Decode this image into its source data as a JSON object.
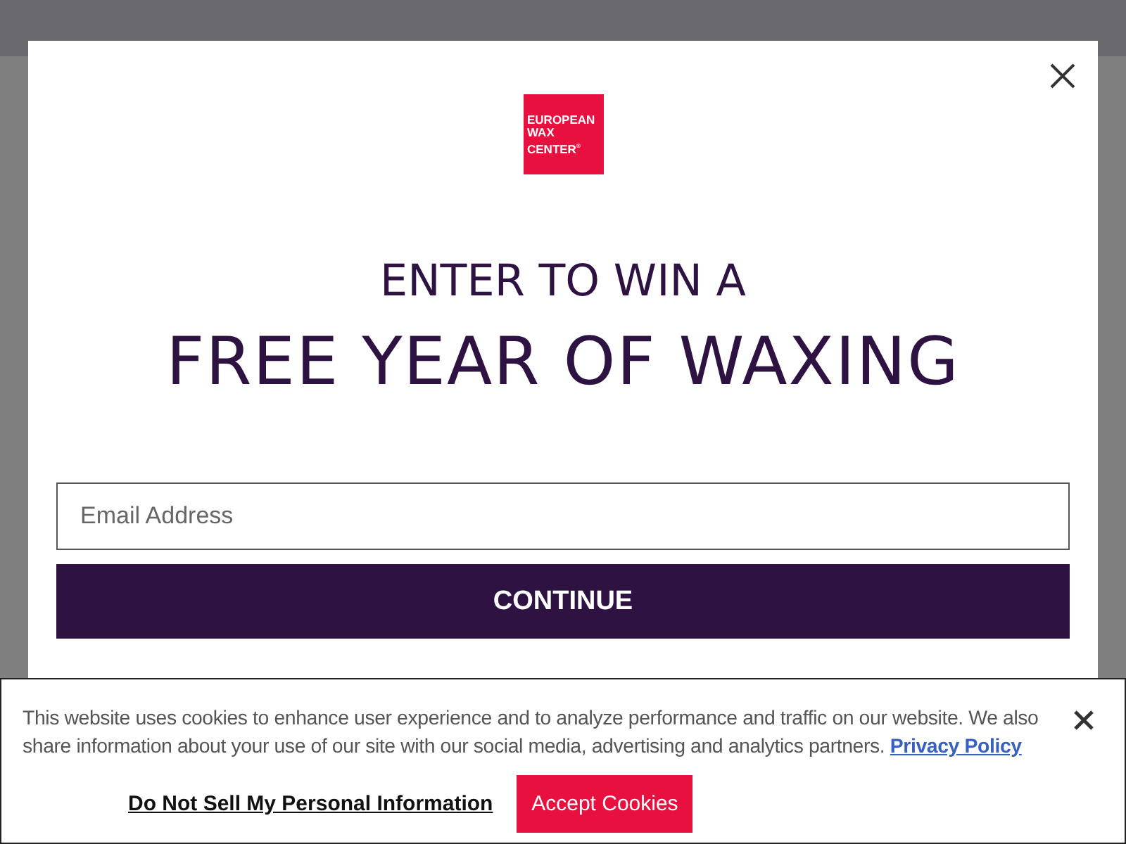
{
  "popup": {
    "logo_lines": [
      "EUROPEAN",
      "WAX",
      "CENTER$^{®}$"
    ],
    "headline": "ENTER TO WIN A",
    "subheadline": "FREE YEAR OF WAXING",
    "email": {
      "placeholder": "Email Address"
    },
    "button": "CONTINUE"
  },
  "cookie_banner": {
    "text": "This website uses cookies to enhance user experience and to analyze performance and traffic on our website. We also share information about your use of our site with our social media, advertising and analytics partners.",
    "link": "Privacy Policy",
    "do_not_sell": "Do Not Sell My Personal Information",
    "accept": "Accept Cookies"
  }
}
